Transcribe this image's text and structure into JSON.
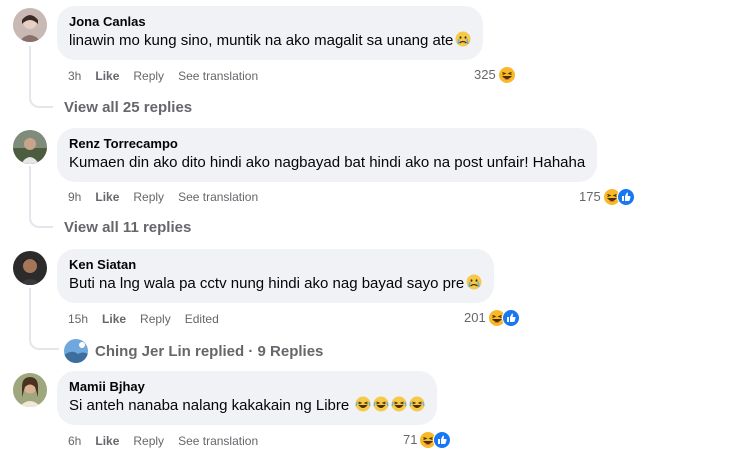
{
  "comments": [
    {
      "author": "Jona Canlas",
      "text": "linawin mo kung sino, muntik na ako magalit sa unang ate",
      "time": "3h",
      "like": "Like",
      "reply": "Reply",
      "extra": "See translation",
      "reaction_count": "325",
      "view_replies": "View all 25 replies"
    },
    {
      "author": "Renz Torrecampo",
      "text": "Kumaen din ako dito hindi ako nagbayad bat hindi ako na post unfair! Hahaha",
      "time": "9h",
      "like": "Like",
      "reply": "Reply",
      "extra": "See translation",
      "reaction_count": "175",
      "view_replies": "View all 11 replies"
    },
    {
      "author": "Ken Siatan",
      "text": "Buti na lng wala pa cctv nung hindi ako nag bayad sayo pre",
      "time": "15h",
      "like": "Like",
      "reply": "Reply",
      "extra": "Edited",
      "reaction_count": "201",
      "replied_text": "Ching Jer Lin replied · 9 Replies"
    },
    {
      "author": "Mamii Bjhay",
      "text": "Si anteh nanaba nalang kakakain ng Libre",
      "time": "6h",
      "like": "Like",
      "reply": "Reply",
      "extra": "See translation",
      "reaction_count": "71"
    }
  ],
  "icons": {
    "haha": "haha-reaction-icon",
    "like": "like-reaction-icon",
    "crying": "crying-emoji-icon",
    "laughing": "laughing-emoji-icon"
  },
  "colors": {
    "bubble": "#f0f2f5",
    "secondary_text": "#65676b",
    "like_blue": "#1877f2",
    "haha_yellow": "#f7b928"
  }
}
